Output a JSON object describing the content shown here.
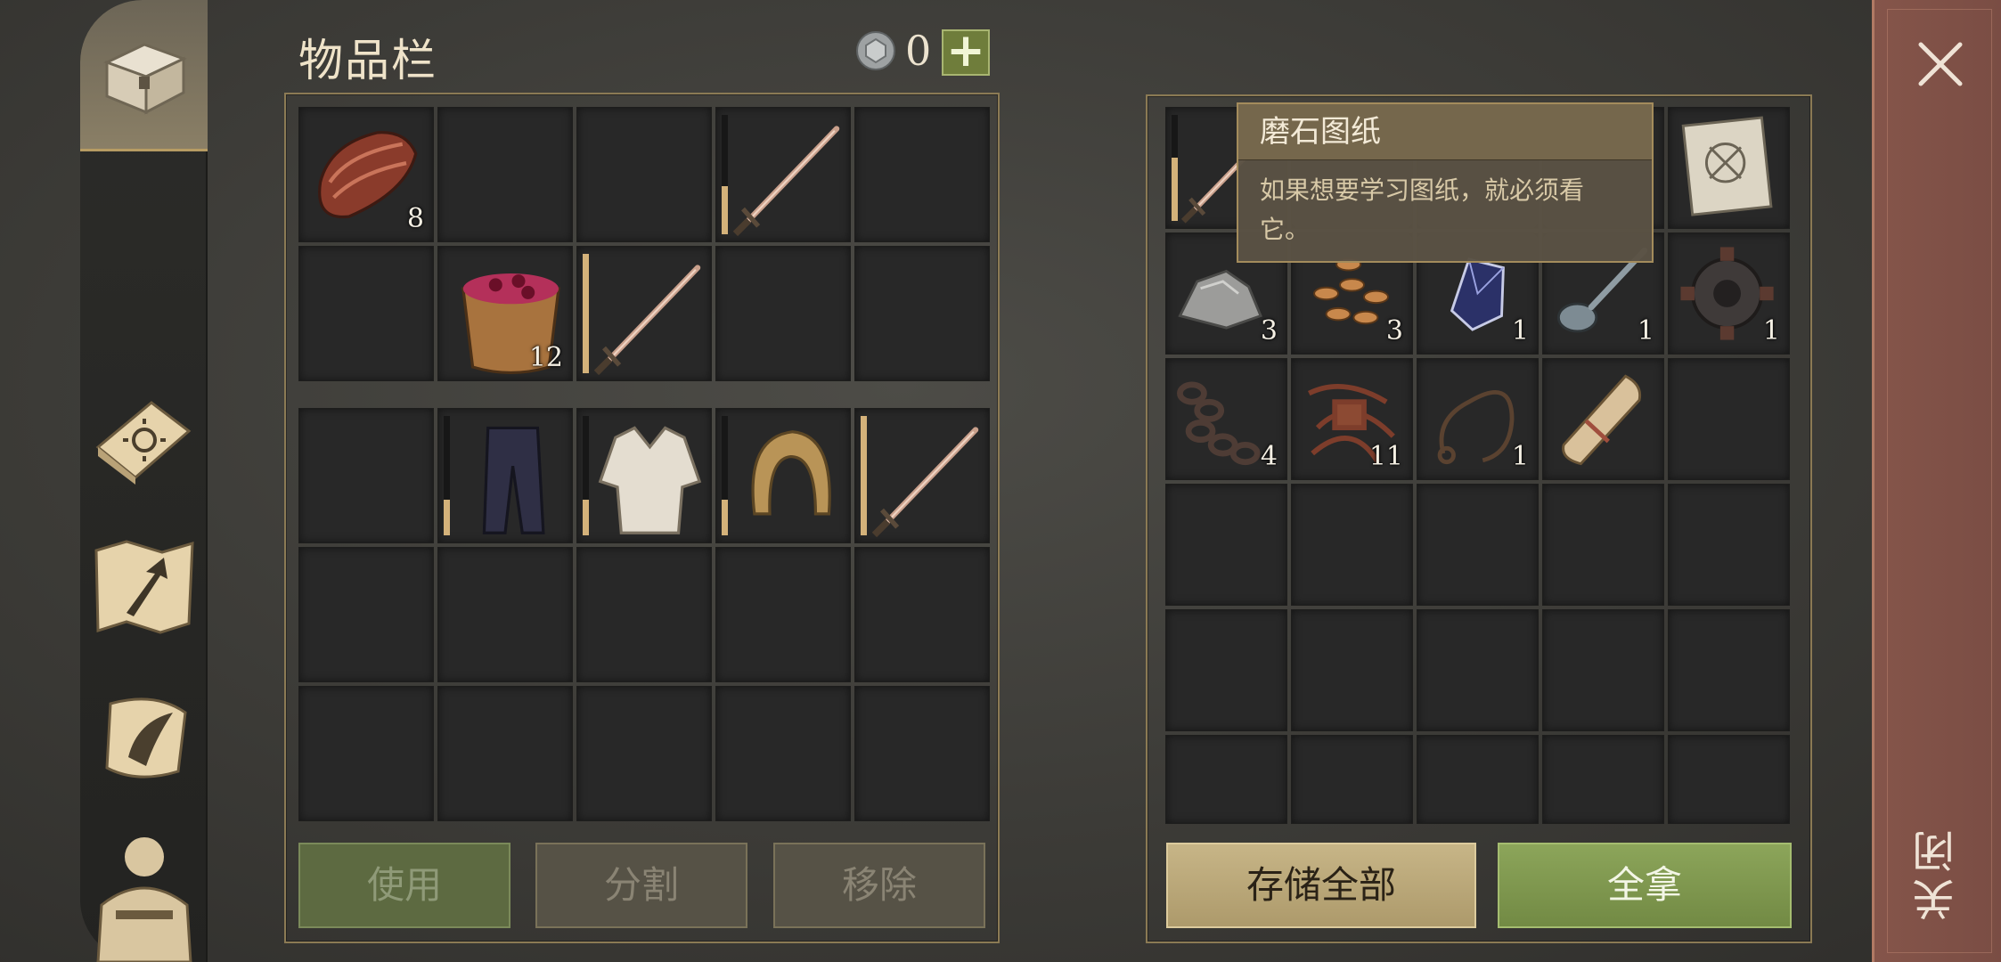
{
  "inventory": {
    "title": "物品栏",
    "currency_count": "0",
    "add_label": "+",
    "buttons": {
      "use": "使用",
      "split": "分割",
      "remove": "移除"
    },
    "pack_slots": [
      {
        "icon": "meat-icon",
        "qty": "8"
      },
      {
        "icon": "",
        "qty": ""
      },
      {
        "icon": "",
        "qty": ""
      },
      {
        "icon": "sword-icon",
        "qty": "",
        "durability": 0.4
      },
      {
        "icon": "",
        "qty": ""
      },
      {
        "icon": "",
        "qty": ""
      },
      {
        "icon": "berry-bucket-icon",
        "qty": "12"
      },
      {
        "icon": "sword-icon",
        "qty": "",
        "durability": 1.0
      },
      {
        "icon": "",
        "qty": ""
      },
      {
        "icon": "",
        "qty": ""
      }
    ],
    "equip_slots": [
      {
        "icon": "",
        "qty": ""
      },
      {
        "icon": "pants-icon",
        "qty": "",
        "durability": 0.3
      },
      {
        "icon": "shirt-icon",
        "qty": "",
        "durability": 0.3
      },
      {
        "icon": "hood-icon",
        "qty": "",
        "durability": 0.3
      },
      {
        "icon": "sword-icon",
        "qty": "",
        "durability": 1.0
      }
    ]
  },
  "storage": {
    "buttons": {
      "store_all": "存储全部",
      "take_all": "全拿"
    },
    "slots": [
      {
        "icon": "sword-icon",
        "qty": "",
        "durability": 0.6
      },
      {
        "icon": "",
        "qty": ""
      },
      {
        "icon": "",
        "qty": ""
      },
      {
        "icon": "",
        "qty": ""
      },
      {
        "icon": "blueprint-icon",
        "qty": ""
      },
      {
        "icon": "stone-icon",
        "qty": "3"
      },
      {
        "icon": "seeds-icon",
        "qty": "3"
      },
      {
        "icon": "crystal-icon",
        "qty": "1"
      },
      {
        "icon": "spoon-icon",
        "qty": "1"
      },
      {
        "icon": "gear-icon",
        "qty": "1"
      },
      {
        "icon": "chain-icon",
        "qty": "4"
      },
      {
        "icon": "scrap-icon",
        "qty": "11"
      },
      {
        "icon": "rope-icon",
        "qty": "1"
      },
      {
        "icon": "scroll-icon",
        "qty": ""
      }
    ]
  },
  "tooltip": {
    "title": "磨石图纸",
    "description": "如果想要学习图纸，就必须看它。"
  },
  "sidebar": {
    "tabs": [
      "chest-icon",
      "book-icon",
      "map-icon",
      "quest-scroll-icon",
      "character-icon"
    ]
  },
  "close": {
    "label": "关闭",
    "icon": "close-icon"
  },
  "colors": {
    "accent_gold": "#c7b587",
    "accent_green": "#8ca55a",
    "close_red": "#85554a"
  }
}
